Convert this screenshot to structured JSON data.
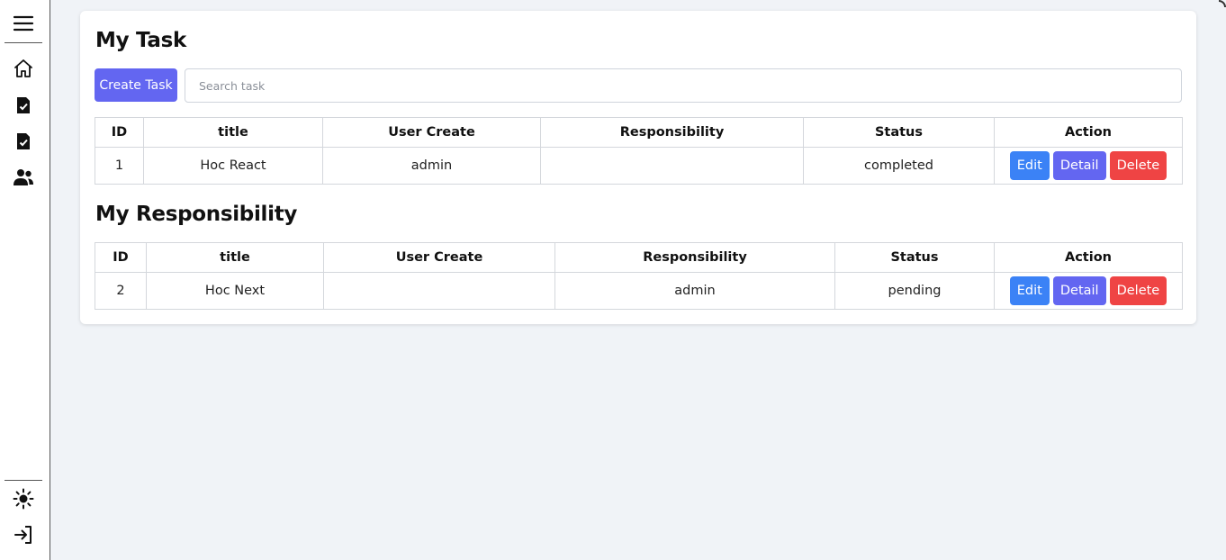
{
  "sidebar": {
    "icons": [
      "menu-icon",
      "home-icon",
      "task-icon",
      "task-icon",
      "users-icon",
      "sun-icon",
      "logout-icon"
    ]
  },
  "my_task": {
    "title": "My Task",
    "create_label": "Create Task",
    "search_placeholder": "Search task",
    "columns": [
      "ID",
      "title",
      "User Create",
      "Responsibility",
      "Status",
      "Action"
    ],
    "rows": [
      {
        "id": "1",
        "title": "Hoc React",
        "user_create": "admin",
        "responsibility": "",
        "status": "completed"
      }
    ]
  },
  "my_responsibility": {
    "title": "My Responsibility",
    "columns": [
      "ID",
      "title",
      "User Create",
      "Responsibility",
      "Status",
      "Action"
    ],
    "rows": [
      {
        "id": "2",
        "title": "Hoc Next",
        "user_create": "",
        "responsibility": "admin",
        "status": "pending"
      }
    ]
  },
  "actions": {
    "edit": "Edit",
    "detail": "Detail",
    "delete": "Delete"
  },
  "colors": {
    "primary": "#6366f1",
    "edit": "#3b82f6",
    "delete": "#ef4444",
    "background": "#f0f3f7"
  }
}
